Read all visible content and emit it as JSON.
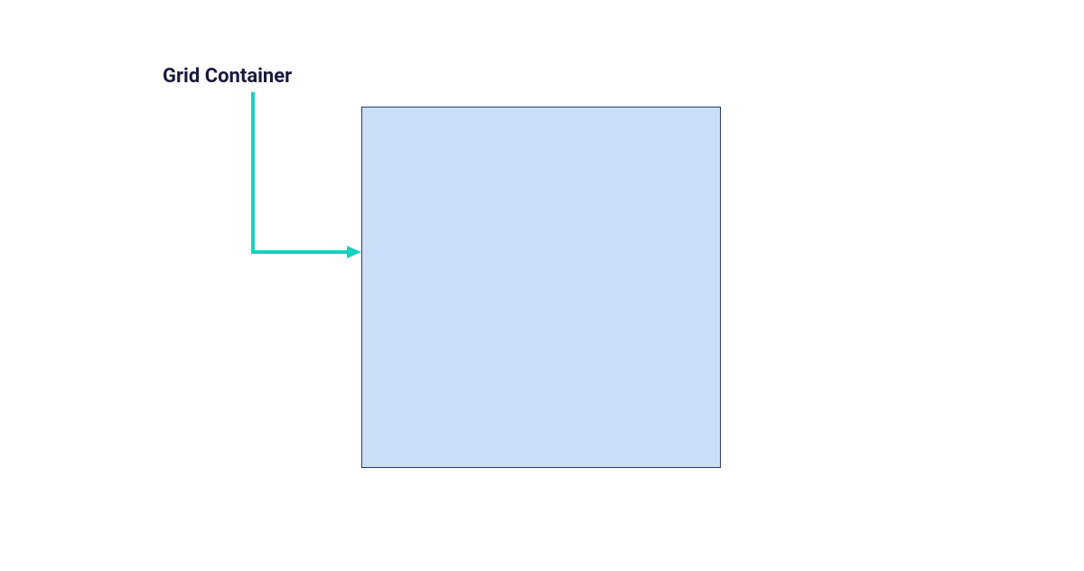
{
  "diagram": {
    "label": "Grid Container",
    "colors": {
      "label_text": "#1a1a3e",
      "arrow": "#16d1c0",
      "box_fill": "#cadef7",
      "box_border": "#2b3a67"
    }
  }
}
